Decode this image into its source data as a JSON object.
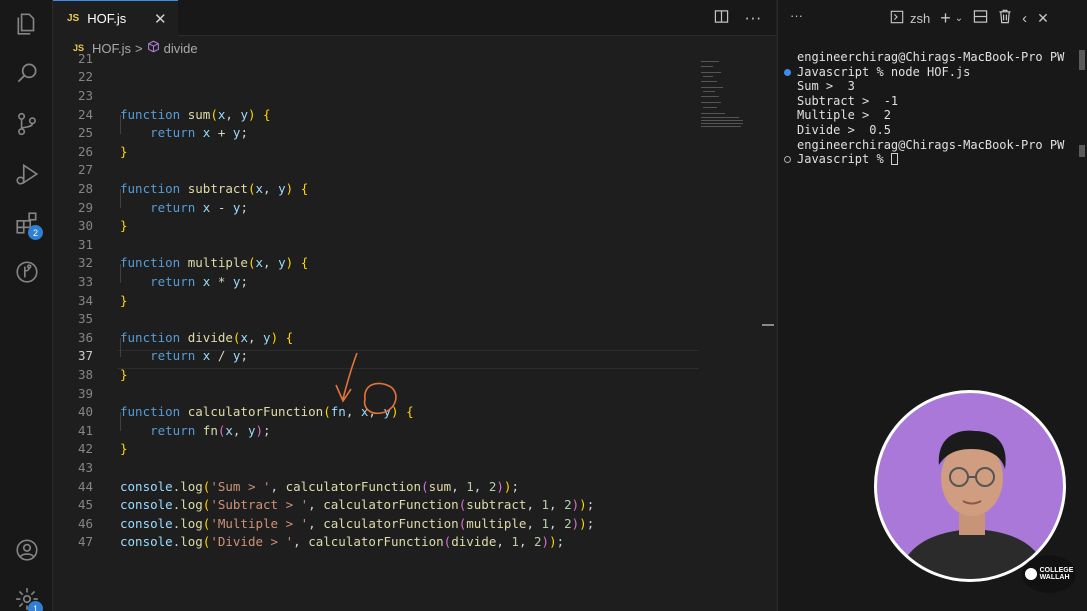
{
  "editor": {
    "tab": {
      "badge": "JS",
      "title": "HOF.js",
      "close": "✕"
    },
    "breadcrumb": {
      "badge": "JS",
      "file": "HOF.js",
      "separator": ">",
      "symbol": "divide"
    },
    "active_line": "37",
    "partial_top_line": "21"
  },
  "activity_bar": {
    "extensions_badge": "2",
    "settings_badge": "1"
  },
  "terminal": {
    "more": "···",
    "shell": "zsh",
    "lines": [
      "engineerchirag@Chirags-MacBook-Pro PW",
      "Javascript % node HOF.js",
      "Sum >  3",
      "Subtract >  -1",
      "Multiple >  2",
      "Divide >  0.5",
      "engineerchirag@Chirags-MacBook-Pro PW",
      "Javascript % "
    ]
  },
  "watermark": {
    "line1": "COLLEGE",
    "line2": "WALLAH"
  },
  "icons": [
    "explorer-icon",
    "search-icon",
    "source-control-icon",
    "run-debug-icon",
    "extensions-icon",
    "git-graph-icon",
    "account-icon",
    "settings-icon",
    "split-editor-icon",
    "more-actions-icon",
    "terminal-icon",
    "plus-icon",
    "chevron-down-icon",
    "split-terminal-icon",
    "trash-icon",
    "chevron-left-icon",
    "close-icon",
    "cube-icon"
  ],
  "colors": {
    "accent": "#3b8eea",
    "keyword": "#569cd6",
    "function": "#dcdcaa",
    "string": "#ce9178",
    "number": "#b5cea8",
    "webcam_bg": "#a978d9",
    "annotation": "#e0743a"
  }
}
